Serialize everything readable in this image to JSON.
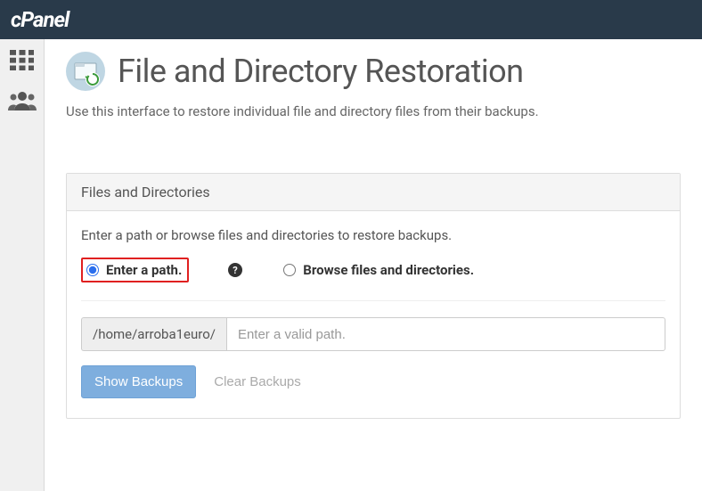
{
  "header": {
    "logo_text": "cPanel"
  },
  "page": {
    "title": "File and Directory Restoration",
    "description": "Use this interface to restore individual file and directory files from their backups."
  },
  "panel": {
    "title": "Files and Directories",
    "instruction": "Enter a path or browse files and directories to restore backups.",
    "radio_enter_path": "Enter a path.",
    "radio_browse": "Browse files and directories.",
    "path_prefix": "/home/arroba1euro/",
    "path_placeholder": "Enter a valid path.",
    "show_backups_label": "Show Backups",
    "clear_backups_label": "Clear Backups"
  }
}
